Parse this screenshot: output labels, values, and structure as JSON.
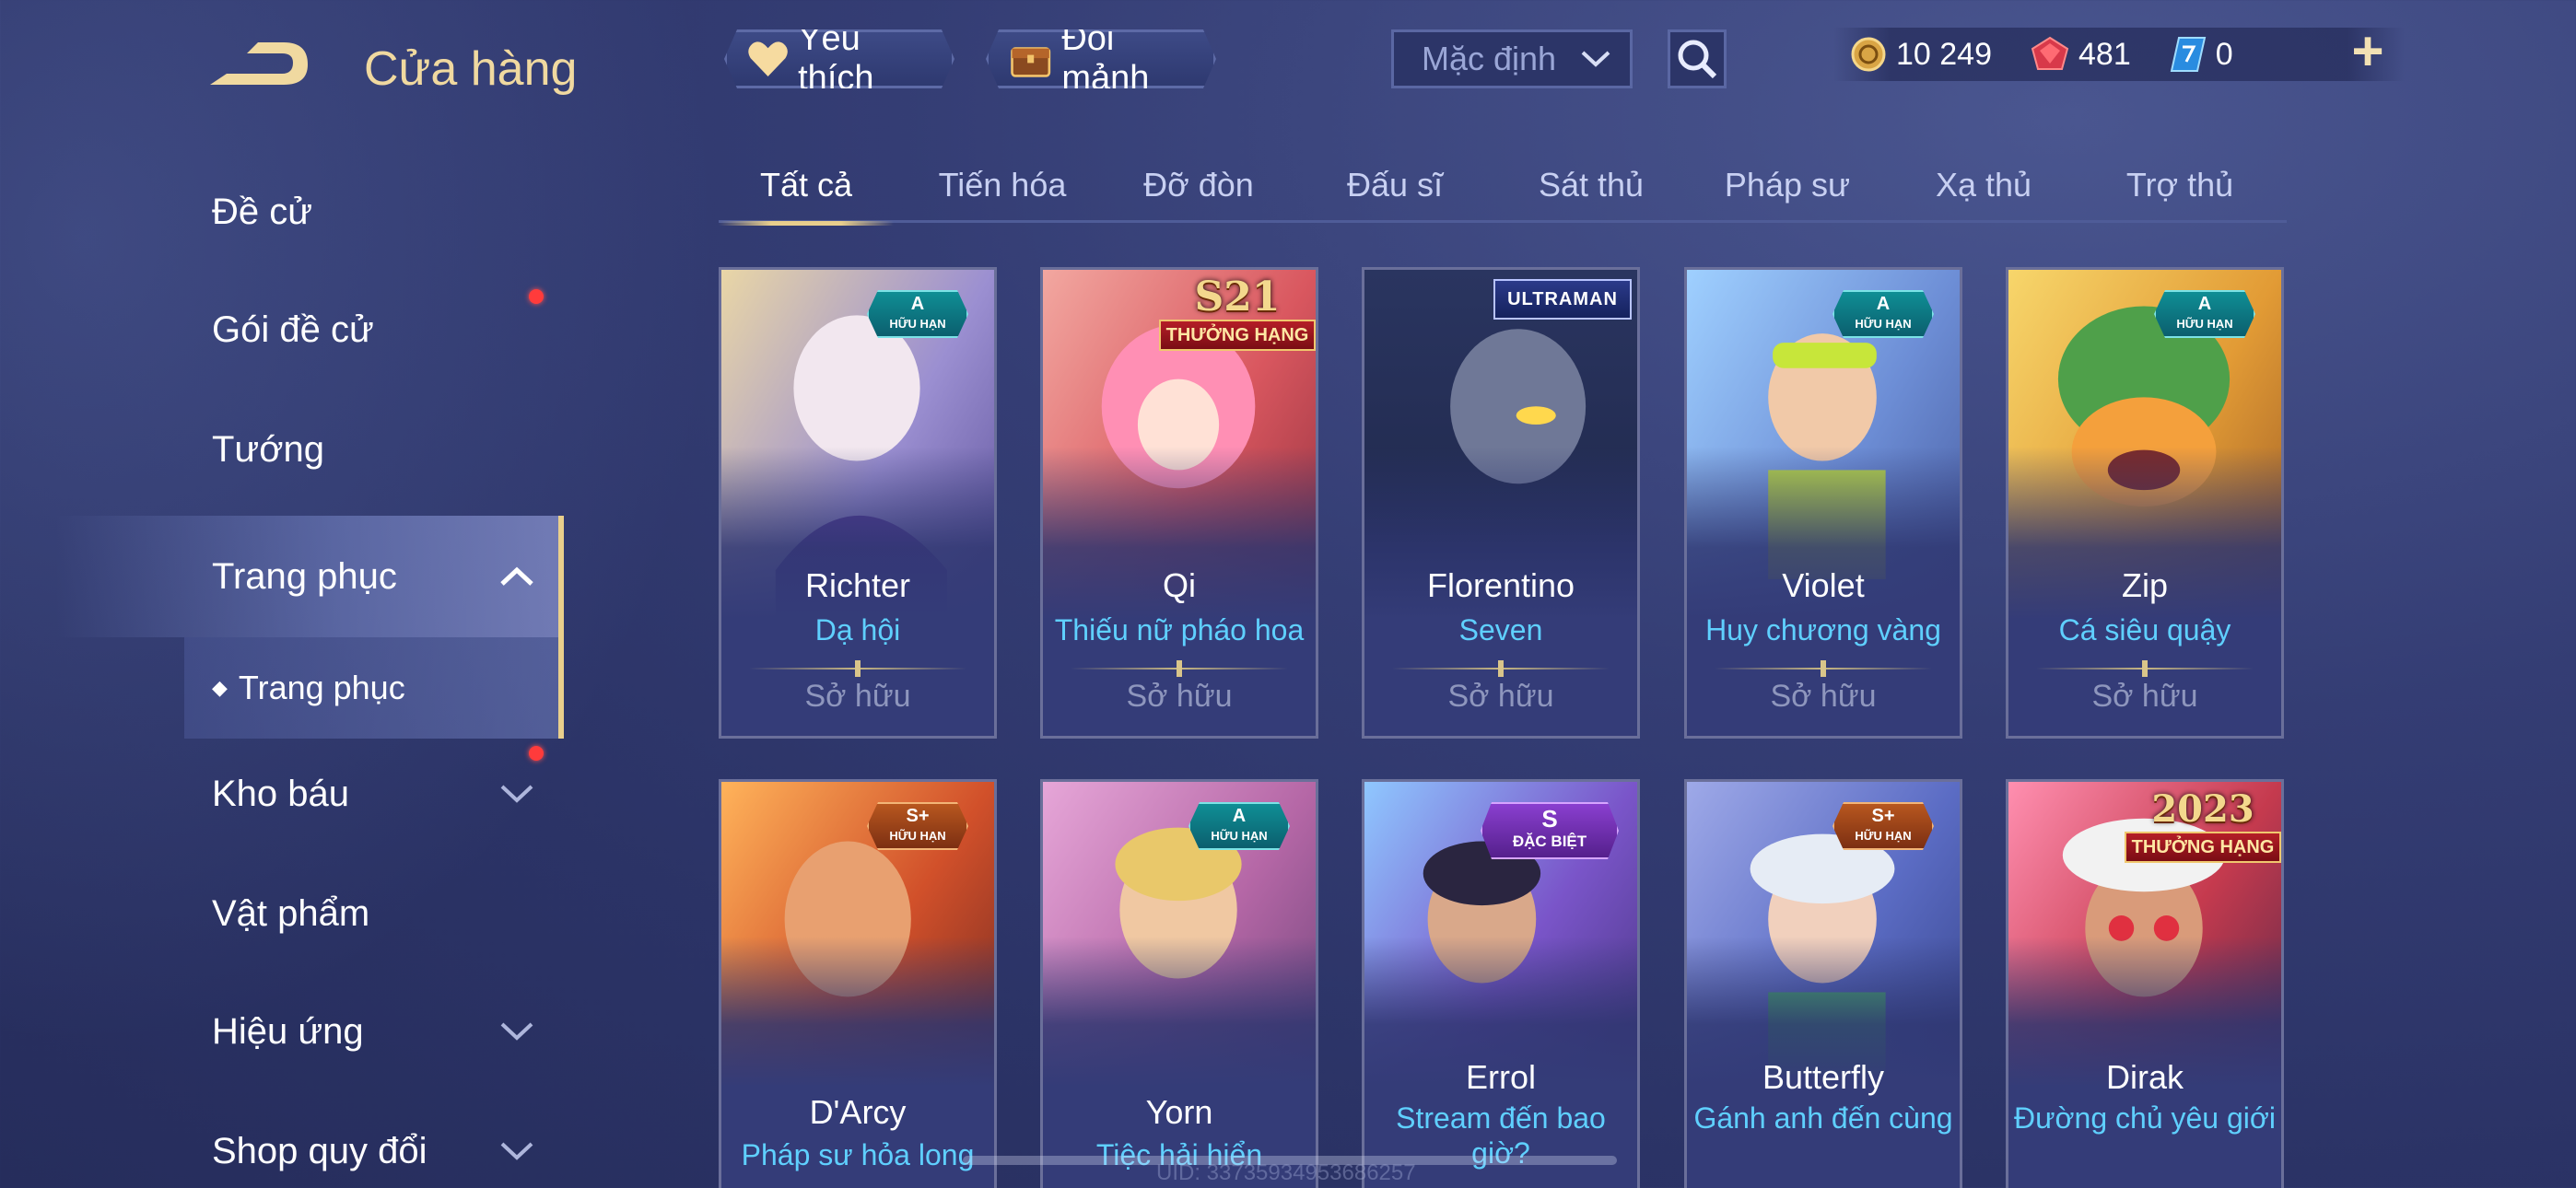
{
  "header": {
    "title": "Cửa hàng",
    "favorites_label": "Yêu thích",
    "shard_exchange_label": "Đổi mảnh",
    "sort_value": "Mặc định",
    "currencies": [
      {
        "icon": "gold-coin-icon",
        "value": "10 249"
      },
      {
        "icon": "red-gem-icon",
        "value": "481"
      },
      {
        "icon": "blue-voucher-icon",
        "value": "0"
      }
    ],
    "plus_label": "+"
  },
  "sidebar": {
    "items": [
      {
        "label": "Đề cử"
      },
      {
        "label": "Gói đề cử"
      },
      {
        "label": "Tướng"
      },
      {
        "label": "Trang phục"
      },
      {
        "label": "Kho báu"
      },
      {
        "label": "Vật phẩm"
      },
      {
        "label": "Hiệu ứng"
      },
      {
        "label": "Shop quy đổi"
      }
    ],
    "sub_item": {
      "label": "Trang phục"
    }
  },
  "tabs": [
    {
      "label": "Tất cả"
    },
    {
      "label": "Tiến hóa"
    },
    {
      "label": "Đỡ đòn"
    },
    {
      "label": "Đấu sĩ"
    },
    {
      "label": "Sát thủ"
    },
    {
      "label": "Pháp sư"
    },
    {
      "label": "Xạ thủ"
    },
    {
      "label": "Trợ thủ"
    }
  ],
  "cards": [
    {
      "hero": "Richter",
      "skin": "Dạ hội",
      "owned": "Sở hữu",
      "badge_top": "A",
      "badge_bottom": "HỮU HẠN"
    },
    {
      "hero": "Qi",
      "skin": "Thiếu nữ pháo hoa",
      "owned": "Sở hữu",
      "season": "S21",
      "season_label": "THƯỞNG HẠNG"
    },
    {
      "hero": "Florentino",
      "skin": "Seven",
      "owned": "Sở hữu",
      "collab": "ULTRAMAN"
    },
    {
      "hero": "Violet",
      "skin": "Huy chương vàng",
      "owned": "Sở hữu",
      "badge_top": "A",
      "badge_bottom": "HỮU HẠN"
    },
    {
      "hero": "Zip",
      "skin": "Cá siêu quậy",
      "owned": "Sở hữu",
      "badge_top": "A",
      "badge_bottom": "HỮU HẠN"
    },
    {
      "hero": "D'Arcy",
      "skin": "Pháp sư hỏa long",
      "badge_top": "S+",
      "badge_bottom": "HỮU HẠN"
    },
    {
      "hero": "Yorn",
      "skin": "Tiệc hải hiển",
      "badge_top": "A",
      "badge_bottom": "HỮU HẠN"
    },
    {
      "hero": "Errol",
      "skin": "Stream đến bao giờ?",
      "badge_top": "S",
      "badge_bottom": "ĐẶC BIỆT"
    },
    {
      "hero": "Butterfly",
      "skin": "Gánh anh đến cùng",
      "badge_top": "S+",
      "badge_bottom": "HỮU HẠN"
    },
    {
      "hero": "Dirak",
      "skin": "Đường chủ yêu giới",
      "season": "2023",
      "season_label": "THƯỞNG HẠNG"
    }
  ],
  "footer": {
    "uid": "UID: 33735934953686257"
  }
}
